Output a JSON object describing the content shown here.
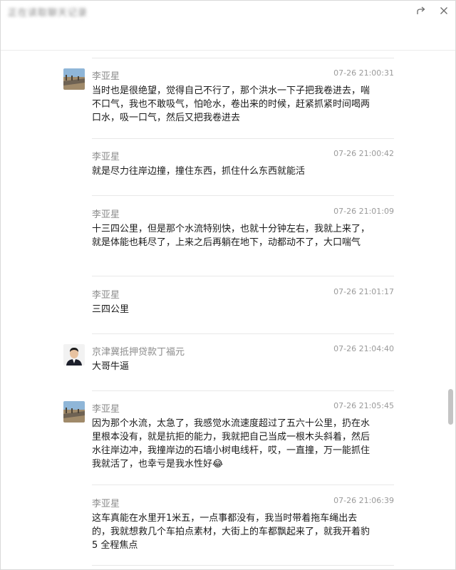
{
  "window": {
    "title": "正在读取聊天记录",
    "share_icon": "share-icon",
    "close_icon": "close-icon"
  },
  "messages": [
    {
      "sender": "李亚星",
      "time": "07-26 21:00:31",
      "avatar": "road-photo-avatar",
      "text": "当时也是很绝望，觉得自己不行了，那个洪水一下子把我卷进去，喘不口气，我也不敢吸气，怕呛水，卷出来的时候，赶紧抓紧时间喝两口水，吸一口气，然后又把我卷进去"
    },
    {
      "sender": "李亚星",
      "time": "07-26 21:00:42",
      "text": "就是尽力往岸边撞，撞住东西，抓住什么东西就能活"
    },
    {
      "sender": "李亚星",
      "time": "07-26 21:01:09",
      "text": "十三四公里，但是那个水流特别快，也就十分钟左右，我就上来了，就是体能也耗尽了，上来之后再躺在地下，动都动不了，大口喘气"
    },
    {
      "sender": "李亚星",
      "time": "07-26 21:01:17",
      "text": "三四公里"
    },
    {
      "sender": "京津冀抵押贷款丁福元",
      "time": "07-26 21:04:40",
      "avatar": "man-portrait-avatar",
      "text": "大哥牛逼"
    },
    {
      "sender": "李亚星",
      "time": "07-26 21:05:45",
      "avatar": "road-photo-avatar",
      "text": "因为那个水流，太急了，我感觉水流速度超过了五六十公里，扔在水里根本没有，就是抗拒的能力，我就把自己当成一根木头斜着，然后水往岸边冲，我撞岸边的石墙小树电线杆，哎，一直撞，万一能抓住我就活了，也幸亏是我水性好😂"
    },
    {
      "sender": "李亚星",
      "time": "07-26 21:06:39",
      "text": "这车真能在水里开1米五，一点事都没有，我当时带着拖车绳出去的，我就想救几个车拍点素材，大街上的车都飘起来了，就我开着豹5 全程焦点"
    }
  ],
  "colors": {
    "timestamp": "#9a9a9a",
    "sender": "#8c8c8c",
    "divider": "#e8e8e8"
  }
}
